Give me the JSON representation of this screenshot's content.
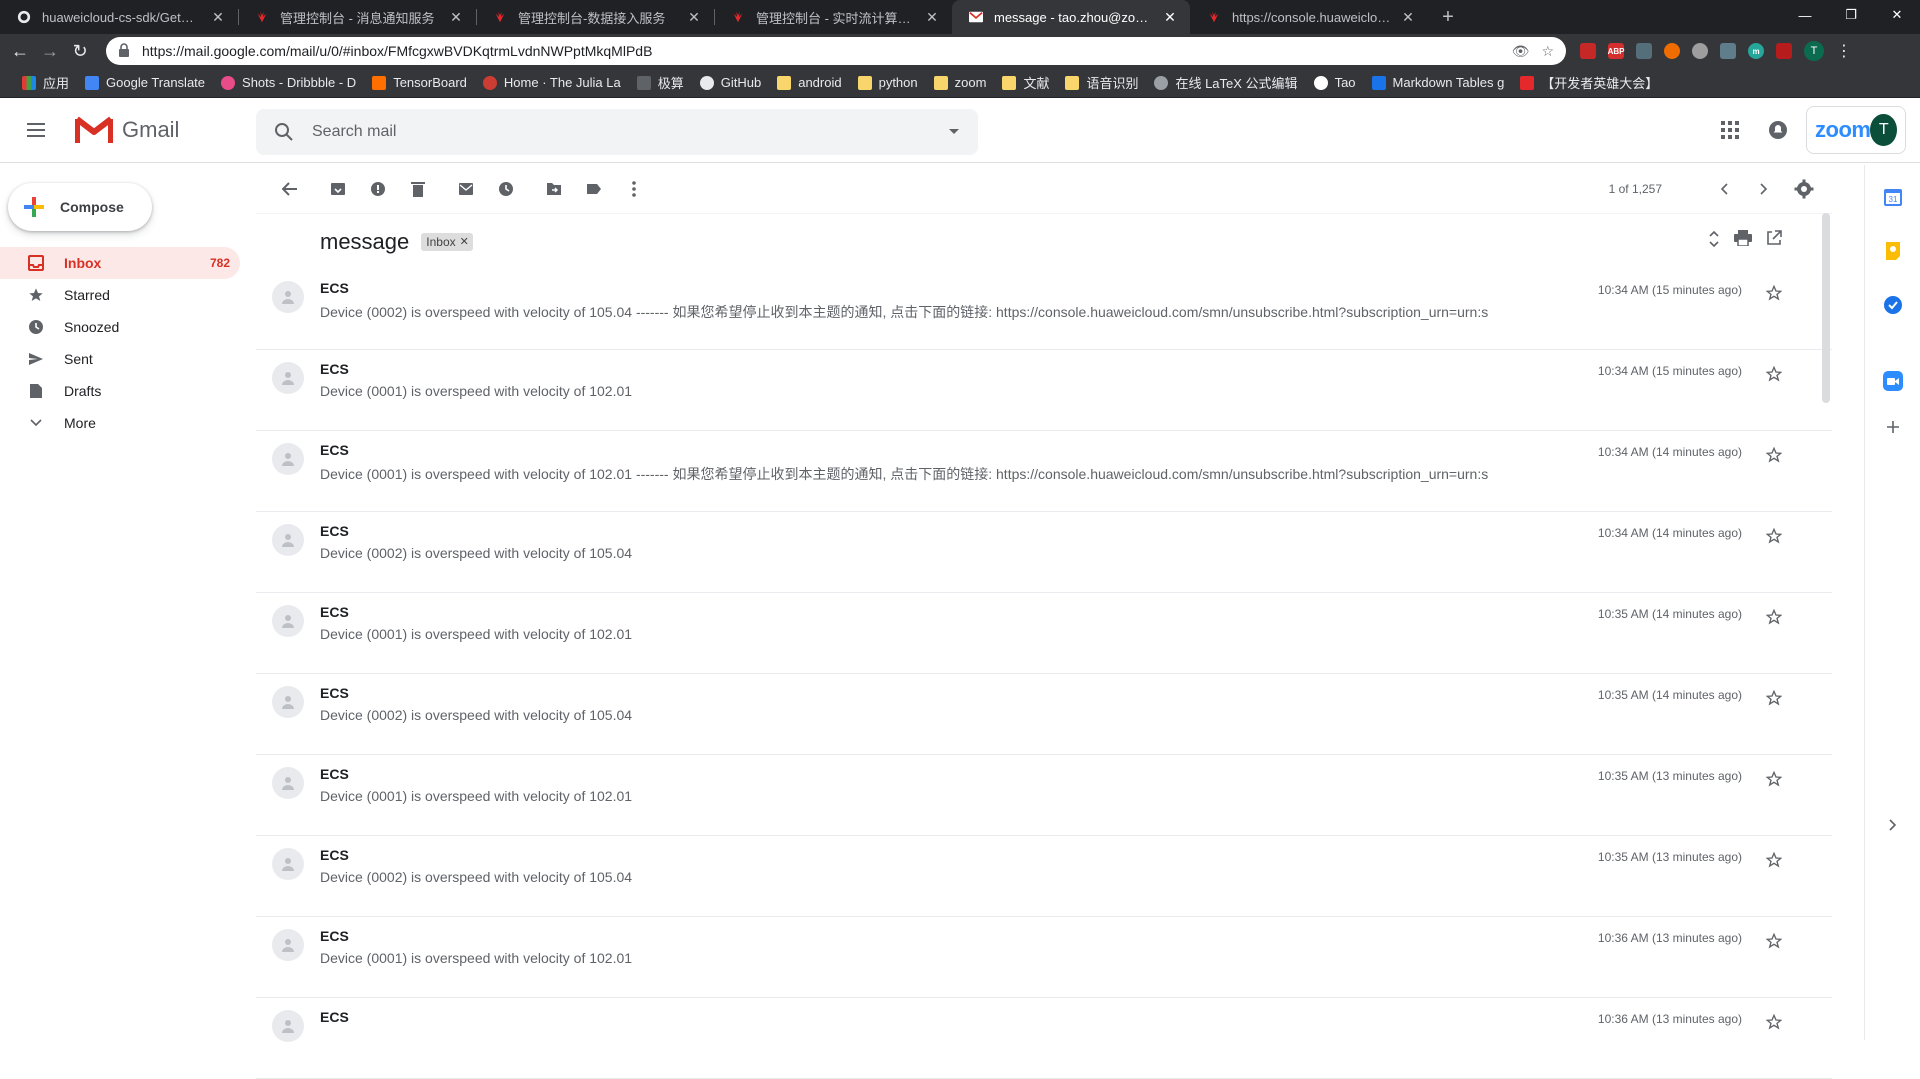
{
  "browser": {
    "tabs": [
      {
        "title": "huaweicloud-cs-sdk/GetStart_",
        "favicon": "github-icon"
      },
      {
        "title": "管理控制台 - 消息通知服务",
        "favicon": "huawei-icon"
      },
      {
        "title": "管理控制台-数据接入服务",
        "favicon": "huawei-icon"
      },
      {
        "title": "管理控制台 - 实时流计算服务 CS",
        "favicon": "huawei-icon"
      },
      {
        "title": "message - tao.zhou@zoom.us",
        "favicon": "gmail-icon"
      },
      {
        "title": "https://console.huaweicloud.c",
        "favicon": "huawei-icon"
      }
    ],
    "url": "https://mail.google.com/mail/u/0/#inbox/FMfcgxwBVDKqtrmLvdnNWPptMkqMlPdB",
    "profile_initial": "T",
    "bookmarks": [
      {
        "label": "应用",
        "icon": "apps-icon"
      },
      {
        "label": "Google Translate",
        "icon": "translate-icon"
      },
      {
        "label": "Shots - Dribbble - D",
        "icon": "dribbble-icon"
      },
      {
        "label": "TensorBoard",
        "icon": "tensorboard-icon"
      },
      {
        "label": "Home · The Julia La",
        "icon": "julia-icon"
      },
      {
        "label": "极算",
        "icon": "link-icon"
      },
      {
        "label": "GitHub",
        "icon": "github-icon"
      },
      {
        "label": "android",
        "icon": "folder-icon"
      },
      {
        "label": "python",
        "icon": "folder-icon"
      },
      {
        "label": "zoom",
        "icon": "folder-icon"
      },
      {
        "label": "文献",
        "icon": "folder-icon"
      },
      {
        "label": "语音识别",
        "icon": "folder-icon"
      },
      {
        "label": "在线 LaTeX 公式编辑",
        "icon": "gear-icon"
      },
      {
        "label": "Tao",
        "icon": "tao-icon"
      },
      {
        "label": "Markdown Tables g",
        "icon": "table-icon"
      },
      {
        "label": "【开发者英雄大会】",
        "icon": "huawei-icon"
      }
    ]
  },
  "gmail": {
    "logo_text": "Gmail",
    "search_placeholder": "Search mail",
    "zoom_label": "zoom",
    "account_initial": "T",
    "compose_label": "Compose",
    "nav": [
      {
        "label": "Inbox",
        "count": "782",
        "icon": "inbox-icon",
        "active": true
      },
      {
        "label": "Starred",
        "count": "",
        "icon": "star-icon"
      },
      {
        "label": "Snoozed",
        "count": "",
        "icon": "clock-icon"
      },
      {
        "label": "Sent",
        "count": "",
        "icon": "send-icon"
      },
      {
        "label": "Drafts",
        "count": "",
        "icon": "draft-icon"
      },
      {
        "label": "More",
        "count": "",
        "icon": "chevron-down-icon"
      }
    ],
    "pager_text": "1 of 1,257",
    "subject": "message",
    "label_chip": "Inbox",
    "messages": [
      {
        "from": "ECS",
        "snippet": "Device (0002) is overspeed with velocity of 105.04 ------- 如果您希望停止收到本主题的通知, 点击下面的链接: https://console.huaweicloud.com/smn/unsubscribe.html?subscription_urn=urn:s",
        "time": "10:34 AM (15 minutes ago)"
      },
      {
        "from": "ECS",
        "snippet": "Device (0001) is overspeed with velocity of 102.01",
        "time": "10:34 AM (15 minutes ago)"
      },
      {
        "from": "ECS",
        "snippet": "Device (0001) is overspeed with velocity of 102.01 ------- 如果您希望停止收到本主题的通知, 点击下面的链接: https://console.huaweicloud.com/smn/unsubscribe.html?subscription_urn=urn:s",
        "time": "10:34 AM (14 minutes ago)"
      },
      {
        "from": "ECS",
        "snippet": "Device (0002) is overspeed with velocity of 105.04",
        "time": "10:34 AM (14 minutes ago)"
      },
      {
        "from": "ECS",
        "snippet": "Device (0001) is overspeed with velocity of 102.01",
        "time": "10:35 AM (14 minutes ago)"
      },
      {
        "from": "ECS",
        "snippet": "Device (0002) is overspeed with velocity of 105.04",
        "time": "10:35 AM (14 minutes ago)"
      },
      {
        "from": "ECS",
        "snippet": "Device (0001) is overspeed with velocity of 102.01",
        "time": "10:35 AM (13 minutes ago)"
      },
      {
        "from": "ECS",
        "snippet": "Device (0002) is overspeed with velocity of 105.04",
        "time": "10:35 AM (13 minutes ago)"
      },
      {
        "from": "ECS",
        "snippet": "Device (0001) is overspeed with velocity of 102.01",
        "time": "10:36 AM (13 minutes ago)"
      },
      {
        "from": "ECS",
        "snippet": "",
        "time": "10:36 AM (13 minutes ago)"
      }
    ]
  },
  "colors": {
    "gmail_red": "#d93025",
    "zoom_blue": "#2d8cff",
    "chrome_dark": "#202124"
  }
}
